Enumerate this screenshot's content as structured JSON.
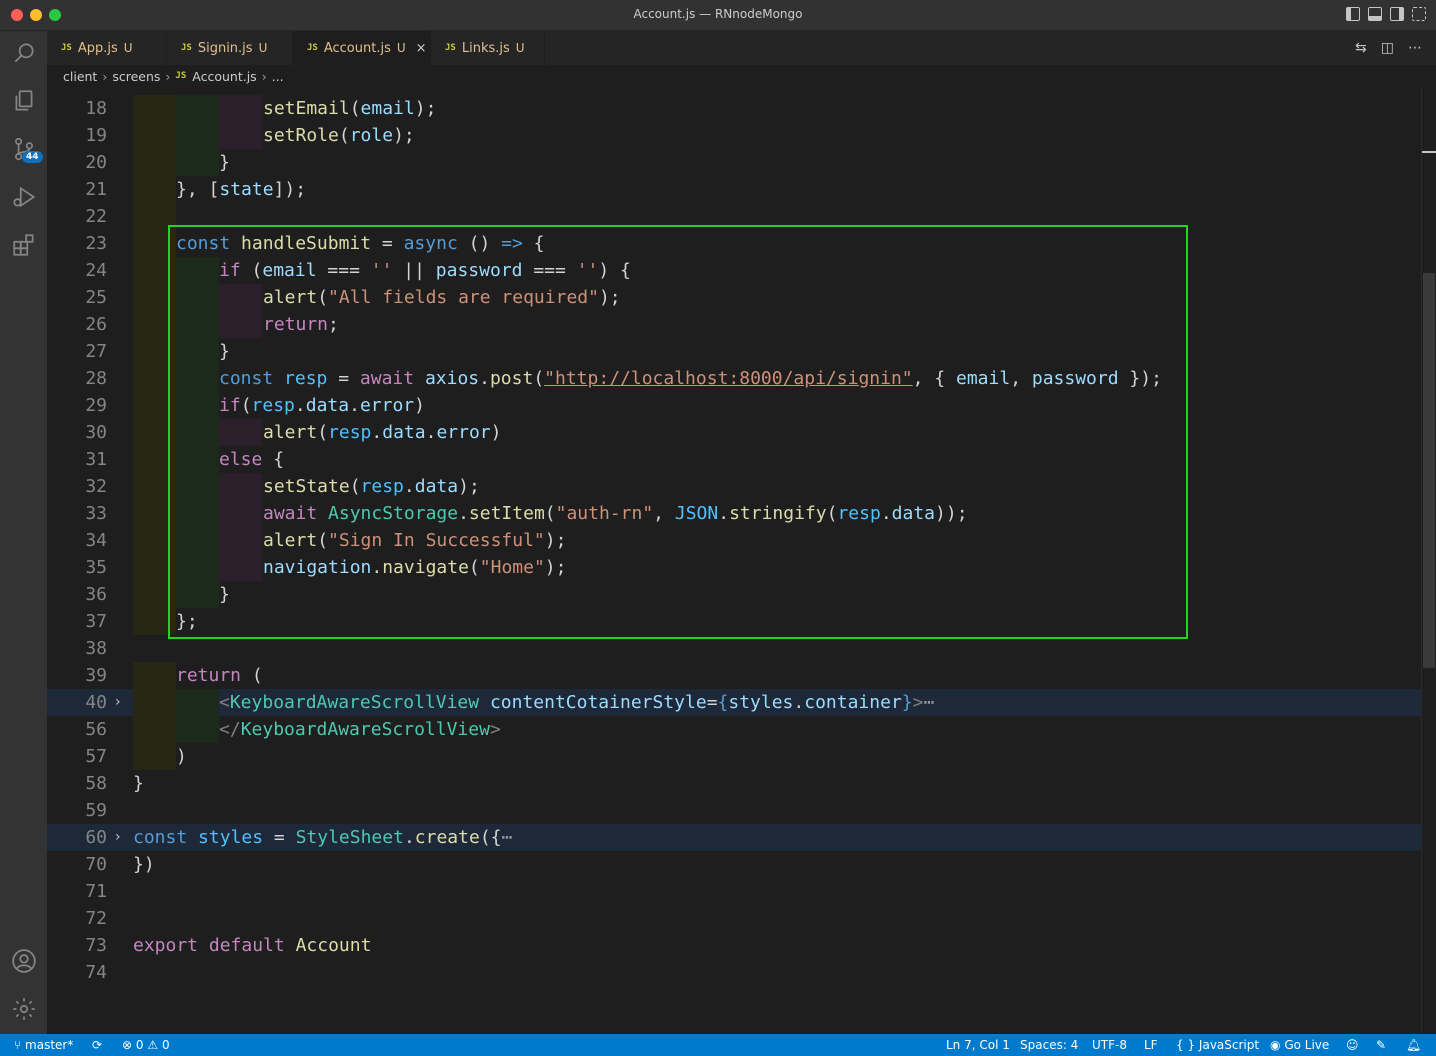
{
  "window": {
    "title": "Account.js — RNnodeMongo",
    "traffic_colors": [
      "#ff5f57",
      "#febc2e",
      "#28c840"
    ]
  },
  "activity_bar": {
    "items": [
      "search-icon",
      "explorer-icon",
      "source-control-icon",
      "run-debug-icon",
      "extensions-icon"
    ],
    "source_control_badge": "44",
    "bottom": [
      "account-icon",
      "settings-gear-icon"
    ]
  },
  "tabs": [
    {
      "badge": "JS",
      "name": "App.js",
      "status": "U",
      "active": false
    },
    {
      "badge": "JS",
      "name": "Signin.js",
      "status": "U",
      "active": false
    },
    {
      "badge": "JS",
      "name": "Account.js",
      "status": "U",
      "active": true,
      "close": "×"
    },
    {
      "badge": "JS",
      "name": "Links.js",
      "status": "U",
      "active": false
    }
  ],
  "breadcrumb": {
    "parts": [
      "client",
      "screens",
      "Account.js",
      "..."
    ],
    "file_badge": "JS"
  },
  "editor": {
    "lines": [
      {
        "num": "18"
      },
      {
        "num": "19"
      },
      {
        "num": "20"
      },
      {
        "num": "21"
      },
      {
        "num": "22"
      },
      {
        "num": "23"
      },
      {
        "num": "24"
      },
      {
        "num": "25"
      },
      {
        "num": "26"
      },
      {
        "num": "27"
      },
      {
        "num": "28"
      },
      {
        "num": "29"
      },
      {
        "num": "30"
      },
      {
        "num": "31"
      },
      {
        "num": "32"
      },
      {
        "num": "33"
      },
      {
        "num": "34"
      },
      {
        "num": "35"
      },
      {
        "num": "36"
      },
      {
        "num": "37"
      },
      {
        "num": "38"
      },
      {
        "num": "39"
      },
      {
        "num": "40"
      },
      {
        "num": "56"
      },
      {
        "num": "57"
      },
      {
        "num": "58"
      },
      {
        "num": "59"
      },
      {
        "num": "60"
      },
      {
        "num": "70"
      },
      {
        "num": "71"
      },
      {
        "num": "72"
      },
      {
        "num": "73"
      },
      {
        "num": "74"
      }
    ],
    "tokens": {
      "setEmail": "setEmail",
      "email": "email",
      "setRole": "setRole",
      "role": "role",
      "state": "state",
      "const": "const",
      "handleSubmit": "handleSubmit",
      "async": "async",
      "arrow": "=>",
      "if": "if",
      "password": "password",
      "alert": "alert",
      "msg_required": "\"All fields are required\"",
      "return": "return",
      "resp": "resp",
      "await": "await",
      "axios": "axios",
      "post": "post",
      "url": "\"http://localhost:8000/api/signin\"",
      "data": "data",
      "error": "error",
      "else": "else",
      "setState": "setState",
      "AsyncStorage": "AsyncStorage",
      "setItem": "setItem",
      "auth_key": "\"auth-rn\"",
      "JSON": "JSON",
      "stringify": "stringify",
      "msg_success": "\"Sign In Successful\"",
      "navigation": "navigation",
      "navigate": "navigate",
      "home": "\"Home\"",
      "KeyboardAwareScrollView": "KeyboardAwareScrollView",
      "contentCotainerStyle": "contentCotainerStyle",
      "styles": "styles",
      "container": "container",
      "StyleSheet": "StyleSheet",
      "create": "create",
      "export": "export",
      "default": "default",
      "Account": "Account",
      "fold_ellipsis": "⋯"
    }
  },
  "statusbar": {
    "branch": "master*",
    "errors": "0",
    "warnings": "0",
    "position": "Ln 7, Col 1",
    "spaces": "Spaces: 4",
    "encoding": "UTF-8",
    "eol": "LF",
    "language": "JavaScript",
    "golive": "Go Live",
    "bg": "#007acc"
  }
}
